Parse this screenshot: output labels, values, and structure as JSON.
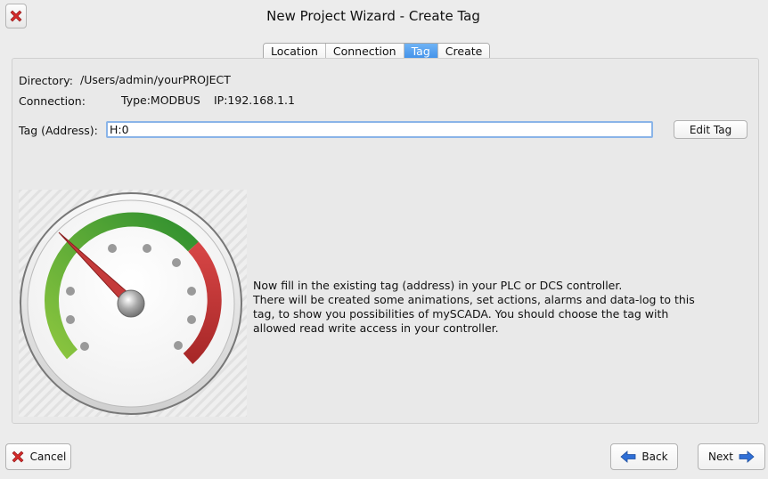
{
  "window": {
    "title": "New Project Wizard - Create Tag"
  },
  "tabs": [
    {
      "label": "Location",
      "active": false
    },
    {
      "label": "Connection",
      "active": false
    },
    {
      "label": "Tag",
      "active": true
    },
    {
      "label": "Create",
      "active": false
    }
  ],
  "info": {
    "directory_label": "Directory:",
    "directory_value": "/Users/admin/yourPROJECT",
    "connection_label": "Connection:",
    "connection_type": "Type:MODBUS",
    "connection_ip": "IP:192.168.1.1"
  },
  "tag": {
    "label": "Tag (Address):",
    "value": "H:0",
    "edit_button": "Edit Tag"
  },
  "description": {
    "lines": [
      "Now fill in the existing tag (address) in your PLC or DCS controller.",
      "There will be created some animations, set actions, alarms and data-log to this",
      "tag, to show you possibilities of mySCADA. You should choose the tag with",
      "allowed read write access in your controller."
    ]
  },
  "footer": {
    "cancel_label": "Cancel",
    "back_label": "Back",
    "next_label": "Next"
  },
  "icons": {
    "close": "close-x-icon",
    "cancel": "red-x-icon",
    "back": "arrow-left-icon",
    "next": "arrow-right-icon",
    "gauge": "gauge-illustration"
  },
  "colors": {
    "accent_tab": "#3d8ee8",
    "gauge_green": "#4a9a2e",
    "gauge_red": "#b83434",
    "close_red": "#d42a2a",
    "arrow_blue": "#2f6fd6"
  }
}
